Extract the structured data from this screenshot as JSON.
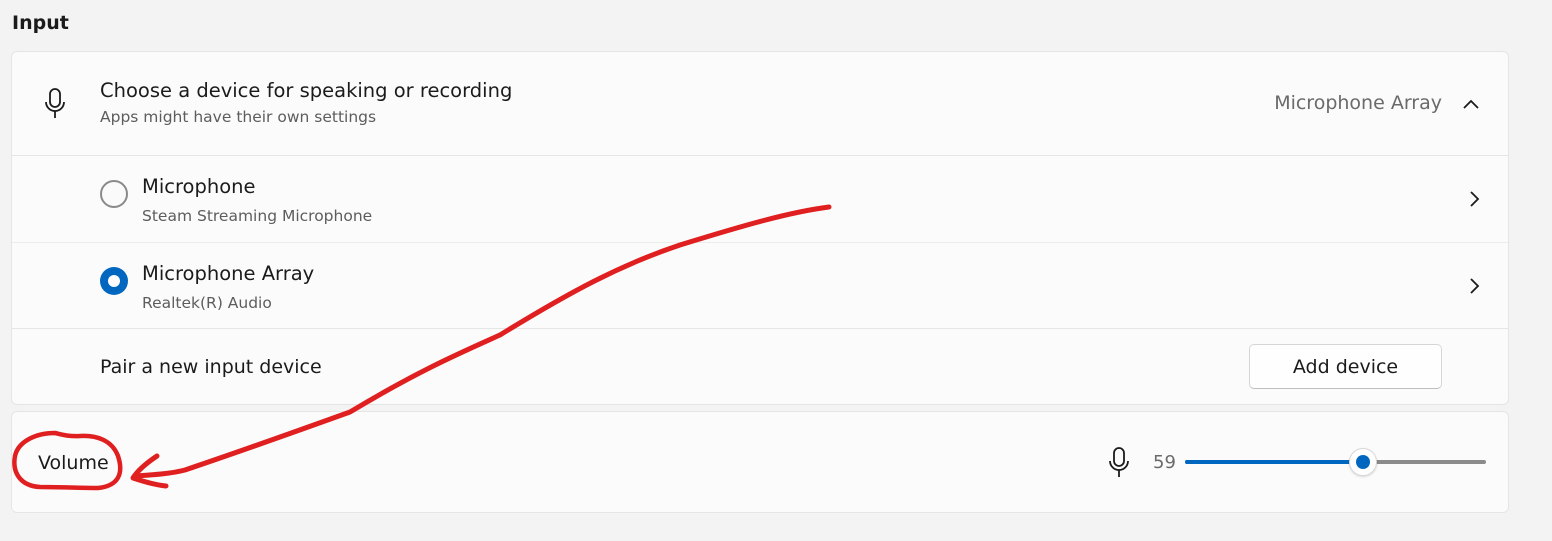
{
  "section": {
    "title": "Input"
  },
  "input_device": {
    "title": "Choose a device for speaking or recording",
    "subtitle": "Apps might have their own settings",
    "selected_value": "Microphone Array",
    "expanded_icon": "chevron-up-icon",
    "device_icon": "microphone-icon",
    "devices": [
      {
        "name": "Microphone",
        "description": "Steam Streaming Microphone",
        "selected": false
      },
      {
        "name": "Microphone Array",
        "description": "Realtek(R) Audio",
        "selected": true
      }
    ]
  },
  "pair": {
    "label": "Pair a new input device",
    "button_label": "Add device"
  },
  "volume": {
    "label": "Volume",
    "value": "59",
    "level_percent": 59,
    "icon": "microphone-icon"
  },
  "colors": {
    "accent": "#0067c0",
    "annotation": "#e02020"
  }
}
